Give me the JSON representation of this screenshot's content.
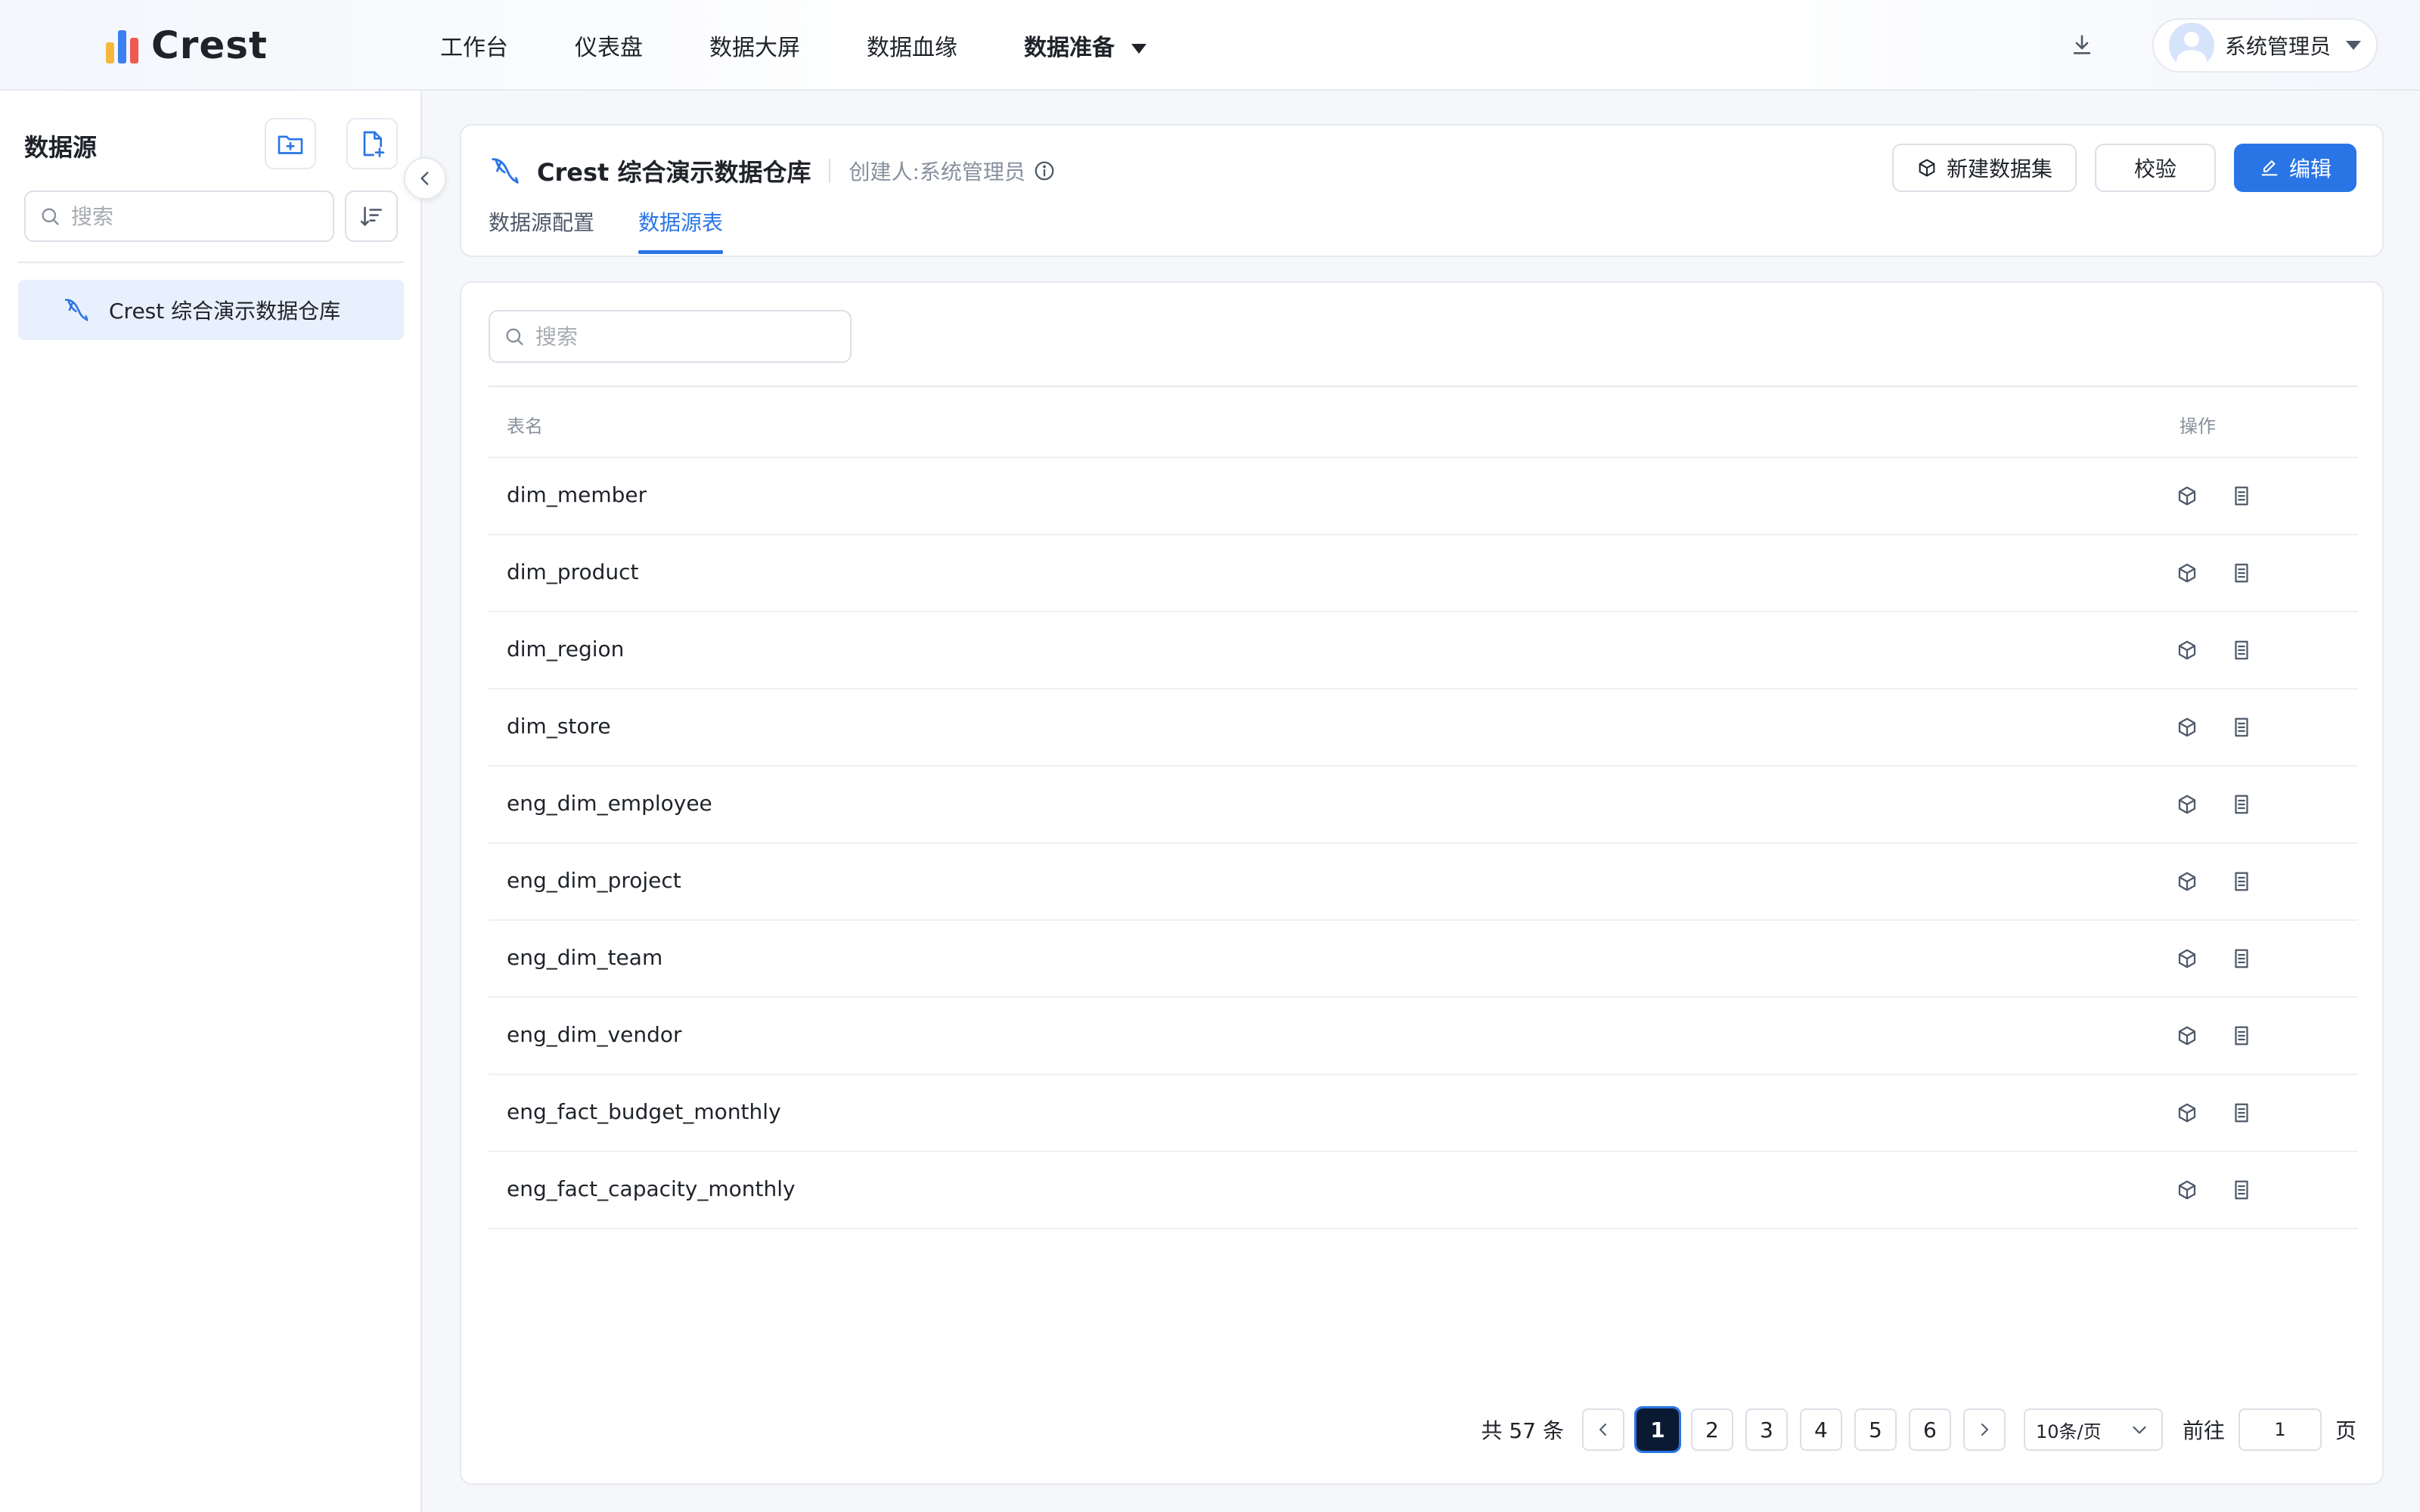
{
  "app": {
    "logo_text": "Crest"
  },
  "nav": {
    "items": [
      "工作台",
      "仪表盘",
      "数据大屏",
      "数据血缘",
      "数据准备"
    ],
    "active": "数据准备",
    "user_name": "系统管理员"
  },
  "sidebar": {
    "title": "数据源",
    "search_placeholder": "搜索",
    "items": [
      {
        "label": "Crest 综合演示数据仓库",
        "selected": true
      }
    ]
  },
  "header": {
    "datasource_name": "Crest 综合演示数据仓库",
    "creator": "创建人:系统管理员",
    "tabs": [
      {
        "label": "数据源配置",
        "active": false
      },
      {
        "label": "数据源表",
        "active": true
      }
    ],
    "buttons": {
      "new_dataset": "新建数据集",
      "validate": "校验",
      "edit": "编辑"
    }
  },
  "table": {
    "search_placeholder": "搜索",
    "columns": {
      "name": "表名",
      "actions": "操作"
    },
    "rows": [
      "dim_member",
      "dim_product",
      "dim_region",
      "dim_store",
      "eng_dim_employee",
      "eng_dim_project",
      "eng_dim_team",
      "eng_dim_vendor",
      "eng_fact_budget_monthly",
      "eng_fact_capacity_monthly"
    ],
    "row_action_icons": [
      "cube-icon",
      "document-icon"
    ]
  },
  "pagination": {
    "total_text": "共 57 条",
    "pages": [
      "1",
      "2",
      "3",
      "4",
      "5",
      "6"
    ],
    "current_page": "1",
    "page_size": "10条/页",
    "goto_label": "前往",
    "goto_value": "1",
    "page_suffix": "页"
  },
  "colors": {
    "primary": "#2a75e6",
    "selected_bg": "#e8f0fd",
    "active_page_bg": "#0b1a33"
  }
}
